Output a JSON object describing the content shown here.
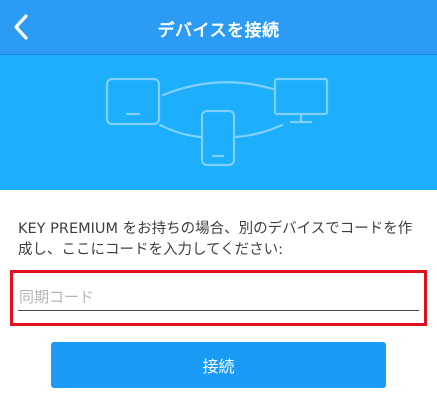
{
  "header": {
    "title": "デバイスを接続",
    "back_icon": "chevron-left-icon"
  },
  "hero": {
    "icons": [
      "tablet-icon",
      "phone-icon",
      "monitor-icon"
    ]
  },
  "instructions": {
    "text": "KEY PREMIUM をお持ちの場合、別のデバイスでコードを作成し、ここにコードを入力してください:"
  },
  "sync_code": {
    "value": "",
    "placeholder": "同期コード"
  },
  "connect_button": {
    "label": "接続"
  },
  "colors": {
    "header": "#2b9bf4",
    "hero": "#1daefc",
    "button": "#1a9cf6",
    "highlight": "#e0101f"
  }
}
